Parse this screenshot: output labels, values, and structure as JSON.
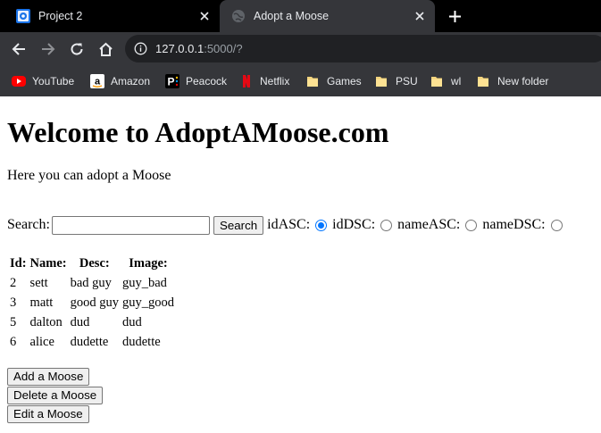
{
  "browser": {
    "tabs": [
      {
        "title": "Project 2",
        "active": false
      },
      {
        "title": "Adopt a Moose",
        "active": true
      }
    ],
    "url": {
      "host": "127.0.0.1",
      "rest": ":5000/?"
    },
    "bookmarks": [
      {
        "label": "YouTube",
        "icon": "youtube-icon"
      },
      {
        "label": "Amazon",
        "icon": "amazon-icon"
      },
      {
        "label": "Peacock",
        "icon": "peacock-icon"
      },
      {
        "label": "Netflix",
        "icon": "netflix-icon"
      },
      {
        "label": "Games",
        "icon": "folder-icon"
      },
      {
        "label": "PSU",
        "icon": "folder-icon"
      },
      {
        "label": "wl",
        "icon": "folder-icon"
      },
      {
        "label": "New folder",
        "icon": "folder-icon"
      }
    ]
  },
  "page": {
    "heading": "Welcome to AdoptAMoose.com",
    "intro": "Here you can adopt a Moose",
    "search": {
      "label": "Search:",
      "value": "",
      "button": "Search",
      "sort_options": [
        {
          "label": "idASC:",
          "checked": true
        },
        {
          "label": "idDSC:",
          "checked": false
        },
        {
          "label": "nameASC:",
          "checked": false
        },
        {
          "label": "nameDSC:",
          "checked": false
        }
      ]
    },
    "table": {
      "headers": [
        "Id:",
        "Name:",
        "Desc:",
        "Image:"
      ],
      "rows": [
        [
          "2",
          "sett",
          "bad guy",
          "guy_bad"
        ],
        [
          "3",
          "matt",
          "good guy",
          "guy_good"
        ],
        [
          "5",
          "dalton",
          "dud",
          "dud"
        ],
        [
          "6",
          "alice",
          "dudette",
          "dudette"
        ]
      ]
    },
    "actions": [
      "Add a Moose",
      "Delete a Moose",
      "Edit a Moose"
    ]
  },
  "colors": {
    "radio_accent": "#0075ff",
    "tabstrip": "#000000",
    "toolbar": "#35363a"
  }
}
